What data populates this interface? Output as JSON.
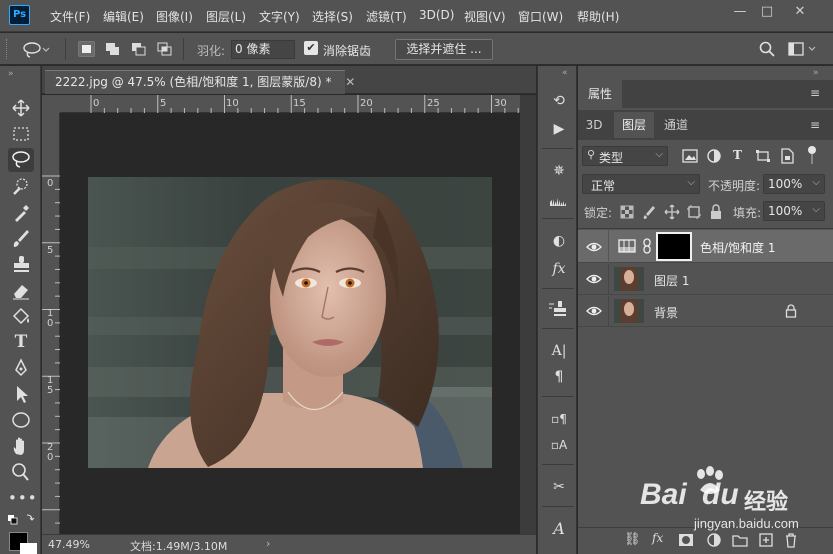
{
  "app": {
    "logo": "Ps"
  },
  "menu": {
    "items": [
      "文件(F)",
      "编辑(E)",
      "图像(I)",
      "图层(L)",
      "文字(Y)",
      "选择(S)",
      "滤镜(T)",
      "3D(D)",
      "视图(V)",
      "窗口(W)",
      "帮助(H)"
    ],
    "minimize": "—",
    "maximize": "□",
    "close": "✕"
  },
  "options": {
    "feather_label": "羽化:",
    "feather_value": "0 像素",
    "antialias_label": "消除锯齿",
    "select_mask_button": "选择并遮住 ..."
  },
  "document": {
    "tab_title": "2222.jpg @ 47.5% (色相/饱和度 1, 图层蒙版/8) *",
    "tab_close": "✕",
    "hruler_labels": [
      "0",
      "5",
      "10",
      "15",
      "20",
      "25",
      "30"
    ],
    "vruler_labels": [
      "0",
      "5",
      "1\n0",
      "1\n5",
      "2\n0"
    ]
  },
  "status": {
    "zoom": "47.49%",
    "doc_info": "文档:1.49M/3.10M",
    "arrow": "›"
  },
  "panel": {
    "header": "属性",
    "tabs": [
      "3D",
      "图层",
      "通道"
    ],
    "active_tab": "图层",
    "filter_kind": "类型",
    "blend_mode": "正常",
    "opacity_label": "不透明度:",
    "opacity_value": "100%",
    "lock_label": "锁定:",
    "fill_label": "填充:",
    "fill_value": "100%",
    "layers": [
      {
        "name": "色相/饱和度 1",
        "type": "adjustment",
        "selected": true
      },
      {
        "name": "图层 1",
        "type": "image",
        "selected": false
      },
      {
        "name": "背景",
        "type": "image",
        "selected": false,
        "locked": true
      }
    ]
  },
  "watermark": {
    "brand": "Bai",
    "brand2": "du",
    "brand_cn": "经验",
    "url": "jingyan.baidu.com"
  },
  "colors": {
    "ui_bg": "#535353",
    "doc_bg": "#282828",
    "selected_layer": "#6a6a6a",
    "accent": "#31a8ff"
  }
}
